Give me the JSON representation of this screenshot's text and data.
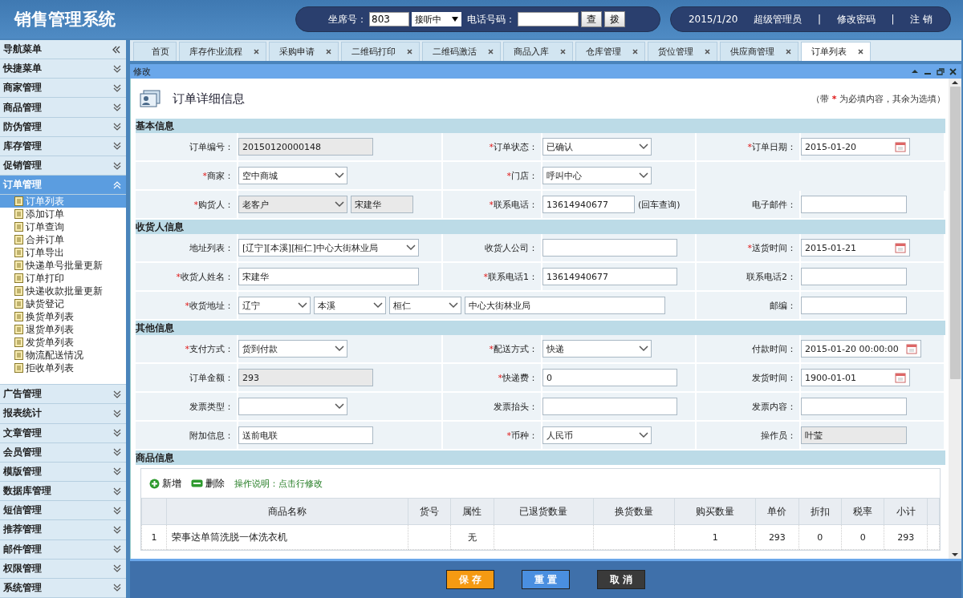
{
  "header": {
    "title": "销售管理系统",
    "seat_label": "坐席号：",
    "seat_value": "803",
    "status_select": "接听中",
    "phone_label": "电话号码：",
    "query_button": "查",
    "dial_button": "拨",
    "date": "2015/1/20",
    "user": "超级管理员",
    "separator_1": "|",
    "change_password": "修改密码",
    "separator_2": "|",
    "logout": "注 销"
  },
  "sidebar": {
    "title": "导航菜单",
    "sections": [
      {
        "label": "快捷菜单",
        "expanded": false
      },
      {
        "label": "商家管理",
        "expanded": false
      },
      {
        "label": "商品管理",
        "expanded": false
      },
      {
        "label": "防伪管理",
        "expanded": false
      },
      {
        "label": "库存管理",
        "expanded": false
      },
      {
        "label": "促销管理",
        "expanded": false
      },
      {
        "label": "订单管理",
        "expanded": true,
        "children": [
          {
            "label": "订单列表",
            "selected": true
          },
          {
            "label": "添加订单",
            "selected": false
          },
          {
            "label": "订单查询",
            "selected": false
          },
          {
            "label": "合并订单",
            "selected": false
          },
          {
            "label": "订单导出",
            "selected": false
          },
          {
            "label": "快递单号批量更新",
            "selected": false
          },
          {
            "label": "订单打印",
            "selected": false
          },
          {
            "label": "快递收款批量更新",
            "selected": false
          },
          {
            "label": "缺货登记",
            "selected": false
          },
          {
            "label": "换货单列表",
            "selected": false
          },
          {
            "label": "退货单列表",
            "selected": false
          },
          {
            "label": "发货单列表",
            "selected": false
          },
          {
            "label": "物流配送情况",
            "selected": false
          },
          {
            "label": "拒收单列表",
            "selected": false
          }
        ]
      },
      {
        "label": "广告管理",
        "expanded": false
      },
      {
        "label": "报表统计",
        "expanded": false
      },
      {
        "label": "文章管理",
        "expanded": false
      },
      {
        "label": "会员管理",
        "expanded": false
      },
      {
        "label": "模版管理",
        "expanded": false
      },
      {
        "label": "数据库管理",
        "expanded": false
      },
      {
        "label": "短信管理",
        "expanded": false
      },
      {
        "label": "推荐管理",
        "expanded": false
      },
      {
        "label": "邮件管理",
        "expanded": false
      },
      {
        "label": "权限管理",
        "expanded": false
      },
      {
        "label": "系统管理",
        "expanded": false
      }
    ]
  },
  "tabs": [
    {
      "label": "首页",
      "selected": false,
      "closable": false
    },
    {
      "label": "库存作业流程",
      "selected": false,
      "closable": true
    },
    {
      "label": "采购申请",
      "selected": false,
      "closable": true
    },
    {
      "label": "二维码打印",
      "selected": false,
      "closable": true
    },
    {
      "label": "二维码激活",
      "selected": false,
      "closable": true
    },
    {
      "label": "商品入库",
      "selected": false,
      "closable": true
    },
    {
      "label": "仓库管理",
      "selected": false,
      "closable": true
    },
    {
      "label": "货位管理",
      "selected": false,
      "closable": true
    },
    {
      "label": "供应商管理",
      "selected": false,
      "closable": true
    },
    {
      "label": "订单列表",
      "selected": true,
      "closable": true
    }
  ],
  "panel": {
    "title": "修改",
    "heading": "订单详细信息",
    "note_before": "（带",
    "note_mark": "*",
    "note_after": "为必填内容，其余为选填）"
  },
  "sections": [
    {
      "title": "基本信息",
      "rows": [
        [
          {
            "label": "订单编号：",
            "controls": [
              {
                "kind": "text",
                "value": "20150120000148",
                "readonly": true
              }
            ]
          },
          {
            "mark": "*",
            "label": "订单状态：",
            "controls": [
              {
                "kind": "select",
                "value": "已确认",
                "readonly": false
              }
            ]
          },
          {
            "mark": "*",
            "label": "订单日期：",
            "controls": [
              {
                "kind": "date",
                "value": "2015-01-20",
                "readonly": false
              }
            ]
          }
        ],
        [
          {
            "mark": "*",
            "label": "商家：",
            "controls": [
              {
                "kind": "select",
                "value": "空中商城",
                "readonly": false
              }
            ]
          },
          {
            "mark": "*",
            "label": "门店：",
            "controls": [
              {
                "kind": "select",
                "value": "呼叫中心",
                "readonly": false
              }
            ]
          },
          null
        ],
        [
          {
            "mark": "*",
            "label": "购货人：",
            "controls": [
              {
                "kind": "select",
                "value": "老客户",
                "readonly": true
              },
              {
                "kind": "short",
                "value": "宋建华",
                "readonly": true
              }
            ]
          },
          {
            "mark": "*",
            "label": "联系电话：",
            "controls": [
              {
                "kind": "text",
                "value": "13614940677",
                "readonly": false
              }
            ],
            "note": "(回车查询)"
          },
          {
            "label": "电子邮件：",
            "controls": [
              {
                "kind": "text",
                "readonly": false
              }
            ]
          }
        ]
      ]
    },
    {
      "title": "收货人信息",
      "rows": [
        [
          {
            "label": "地址列表：",
            "controls": [
              {
                "kind": "wideselect",
                "value": "[辽宁][本溪][桓仁]中心大街林业局",
                "readonly": false
              }
            ]
          },
          {
            "label": "收货人公司：",
            "controls": [
              {
                "kind": "text",
                "readonly": false
              }
            ]
          },
          {
            "mark": "*",
            "label": "送货时间：",
            "controls": [
              {
                "kind": "date",
                "value": "2015-01-21",
                "readonly": false
              }
            ]
          }
        ],
        [
          {
            "mark": "*",
            "label": "收货人姓名：",
            "controls": [
              {
                "kind": "wide",
                "value": "宋建华",
                "readonly": false
              }
            ]
          },
          {
            "mark": "*",
            "label": "联系电话1：",
            "controls": [
              {
                "kind": "text",
                "value": "13614940677",
                "readonly": false
              }
            ]
          },
          {
            "label": "联系电话2：",
            "controls": [
              {
                "kind": "text",
                "readonly": false
              }
            ]
          }
        ],
        [
          {
            "mark": "*",
            "label": "收货地址：",
            "controls": [
              {
                "kind": "smallselect",
                "value": "辽宁",
                "readonly": false
              },
              {
                "kind": "smallselect",
                "value": "本溪",
                "readonly": false
              },
              {
                "kind": "smallselect",
                "value": "桓仁",
                "readonly": false
              },
              {
                "kind": "long",
                "value": "中心大街林业局",
                "readonly": false
              }
            ]
          },
          null,
          {
            "label": "邮编：",
            "controls": [
              {
                "kind": "text",
                "readonly": false
              }
            ]
          }
        ]
      ]
    },
    {
      "title": "其他信息",
      "rows": [
        [
          {
            "mark": "*",
            "label": "支付方式：",
            "controls": [
              {
                "kind": "select",
                "value": "货到付款",
                "readonly": false
              }
            ]
          },
          {
            "mark": "*",
            "label": "配送方式：",
            "controls": [
              {
                "kind": "select",
                "value": "快递",
                "readonly": false
              }
            ]
          },
          {
            "label": "付款时间：",
            "controls": [
              {
                "kind": "date",
                "value": "2015-01-20 00:00:00",
                "readonly": false
              }
            ]
          }
        ],
        [
          {
            "label": "订单金额：",
            "controls": [
              {
                "kind": "text",
                "value": "293",
                "readonly": true
              }
            ]
          },
          {
            "mark": "*",
            "label": "快递费：",
            "controls": [
              {
                "kind": "text",
                "value": "0",
                "readonly": false
              }
            ]
          },
          {
            "label": "发货时间：",
            "controls": [
              {
                "kind": "date",
                "value": "1900-01-01",
                "readonly": false
              }
            ]
          }
        ],
        [
          {
            "label": "发票类型：",
            "controls": [
              {
                "kind": "select",
                "readonly": false
              }
            ]
          },
          {
            "label": "发票抬头：",
            "controls": [
              {
                "kind": "text",
                "readonly": false
              }
            ]
          },
          {
            "label": "发票内容：",
            "controls": [
              {
                "kind": "text",
                "readonly": false
              }
            ]
          }
        ],
        [
          {
            "label": "附加信息：",
            "controls": [
              {
                "kind": "text",
                "value": "送前电联",
                "readonly": false
              }
            ]
          },
          {
            "mark": "*",
            "label": "币种：",
            "controls": [
              {
                "kind": "select",
                "value": "人民币",
                "readonly": false
              }
            ]
          },
          {
            "label": "操作员：",
            "controls": [
              {
                "kind": "text",
                "value": "叶莹",
                "readonly": true
              }
            ]
          }
        ]
      ]
    }
  ],
  "goods": {
    "title": "商品信息",
    "add": "新增",
    "delete": "删除",
    "hint": "操作说明：点击行修改",
    "columns": [
      "商品名称",
      "货号",
      "属性",
      "已退货数量",
      "换货数量",
      "购买数量",
      "单价",
      "折扣",
      "税率",
      "小计"
    ],
    "rows": [
      {
        "index": "1",
        "cells": [
          "荣事达单筒洗脱一体洗衣机",
          null,
          "无",
          null,
          null,
          "1",
          "293",
          "0",
          "0",
          "293"
        ]
      }
    ]
  },
  "buttons": [
    {
      "label": "保 存",
      "color": "#f59a12"
    },
    {
      "label": "重 置",
      "color": "#4a8fe0"
    },
    {
      "label": "取 消",
      "color": "#3a3a3a"
    }
  ]
}
